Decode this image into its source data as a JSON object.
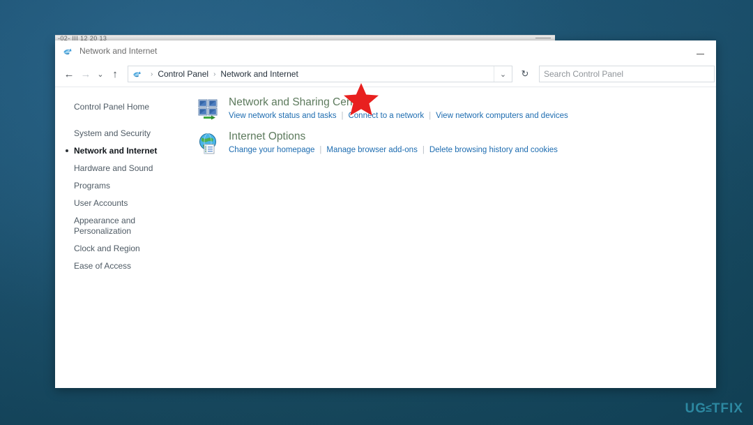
{
  "desktop": {
    "watermark": {
      "left": "UG",
      "middle": "≤",
      "right": "TFIX"
    }
  },
  "background_window": {
    "title_fragment": "-02- III 12 20 13"
  },
  "window": {
    "title": "Network and Internet",
    "title_icon": "network-icon",
    "controls": {
      "minimize": "minimize-icon"
    }
  },
  "navigation": {
    "back": "←",
    "forward": "→",
    "recent": "⌄",
    "up": "↑",
    "refresh": "↻",
    "breadcrumb": {
      "icon": "network-icon",
      "separator": "›",
      "items": [
        "Control Panel",
        "Network and Internet"
      ]
    },
    "dropdown_chevron": "⌄"
  },
  "search": {
    "placeholder": "Search Control Panel",
    "value": ""
  },
  "sidebar": {
    "items": [
      {
        "label": "Control Panel Home",
        "active": false,
        "home": true
      },
      {
        "label": "System and Security",
        "active": false,
        "home": false
      },
      {
        "label": "Network and Internet",
        "active": true,
        "home": false
      },
      {
        "label": "Hardware and Sound",
        "active": false,
        "home": false
      },
      {
        "label": "Programs",
        "active": false,
        "home": false
      },
      {
        "label": "User Accounts",
        "active": false,
        "home": false
      },
      {
        "label": "Appearance and Personalization",
        "active": false,
        "home": false
      },
      {
        "label": "Clock and Region",
        "active": false,
        "home": false
      },
      {
        "label": "Ease of Access",
        "active": false,
        "home": false
      }
    ]
  },
  "main": {
    "categories": [
      {
        "icon": "network-sharing-center-icon",
        "title": "Network and Sharing Center",
        "links": [
          "View network status and tasks",
          "Connect to a network",
          "View network computers and devices"
        ]
      },
      {
        "icon": "internet-options-icon",
        "title": "Internet Options",
        "links": [
          "Change your homepage",
          "Manage browser add-ons",
          "Delete browsing history and cookies"
        ]
      }
    ],
    "annotation": {
      "type": "star",
      "color": "#e8201f",
      "target_link": "Connect to a network"
    }
  },
  "colors": {
    "desktop": "#1d5878",
    "heading_green": "#5d7a5d",
    "link_blue": "#1d6cb0",
    "annotation_red": "#e8201f",
    "watermark": "#2f8fa8"
  }
}
